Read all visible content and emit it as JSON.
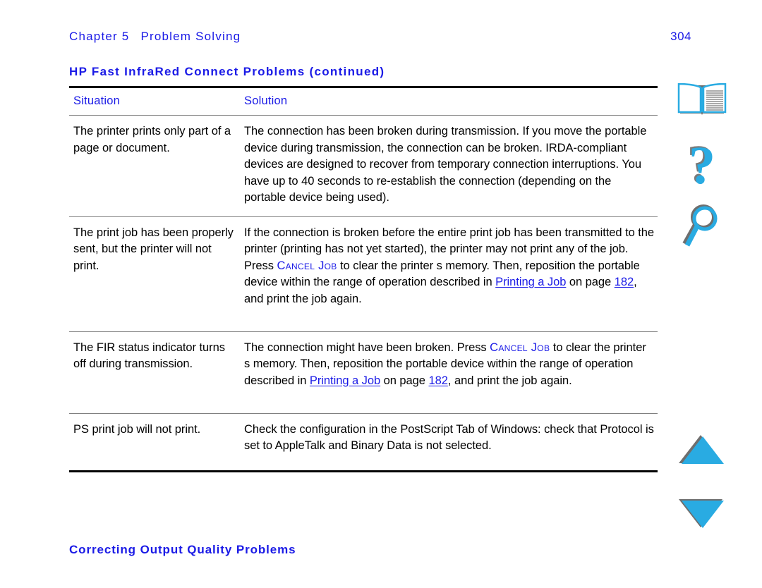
{
  "header": {
    "chapter": "Chapter 5",
    "chapter_title": "Problem Solving",
    "page_number": "304"
  },
  "table": {
    "title": "HP Fast InfraRed Connect Problems (continued)",
    "columns": {
      "situation": "Situation",
      "solution": "Solution"
    },
    "rows": [
      {
        "situation": "The printer prints only part of a page or document.",
        "solution_parts": [
          {
            "type": "text",
            "text": "The connection has been broken during transmission. If you move the portable device during transmission, the connection can be broken. IRDA-compliant devices are designed to recover from temporary connection interruptions. You have up to 40 seconds to re-establish the connection (depending on the portable device being used)."
          }
        ]
      },
      {
        "situation": "The print job has been properly sent, but the printer will not print.",
        "solution_parts": [
          {
            "type": "text",
            "text": "If the connection is broken before the entire print job has been transmitted to the printer (printing has not yet started), the printer may not print any of the job. Press "
          },
          {
            "type": "smallcaps",
            "text": "Cancel Job"
          },
          {
            "type": "text",
            "text": " to clear the printer s memory. Then, reposition the portable device within the range of operation described in "
          },
          {
            "type": "link",
            "text": "Printing a Job"
          },
          {
            "type": "text",
            "text": " on page "
          },
          {
            "type": "link",
            "text": "182"
          },
          {
            "type": "text",
            "text": ", and print the job again."
          }
        ]
      },
      {
        "situation": "The FIR status indicator turns off during transmission.",
        "solution_parts": [
          {
            "type": "text",
            "text": "The connection might have been broken. Press "
          },
          {
            "type": "smallcaps",
            "text": "Cancel Job"
          },
          {
            "type": "text",
            "text": " to clear the printer s memory. Then, reposition the portable device within the range of operation described in "
          },
          {
            "type": "link",
            "text": "Printing a Job"
          },
          {
            "type": "text",
            "text": " on page "
          },
          {
            "type": "link",
            "text": "182"
          },
          {
            "type": "text",
            "text": ", and print the job again."
          }
        ]
      },
      {
        "situation": "PS print job will not print.",
        "solution_parts": [
          {
            "type": "text",
            "text": "Check the configuration in the PostScript Tab of Windows: check that Protocol is set to AppleTalk and Binary Data is not selected."
          }
        ]
      }
    ]
  },
  "footer": {
    "section_title": "Correcting Output Quality Problems"
  },
  "nav": {
    "book_icon": "book-icon",
    "help_icon": "question-mark-icon",
    "search_icon": "magnifier-icon",
    "up_icon": "triangle-up-icon",
    "down_icon": "triangle-down-icon",
    "help_glyph": "?"
  },
  "colors": {
    "link_blue": "#1a1ae6",
    "icon_cyan": "#29ABE2",
    "icon_shadow": "#7a7a7a",
    "rule_black": "#000000",
    "rule_grey": "#808080"
  }
}
